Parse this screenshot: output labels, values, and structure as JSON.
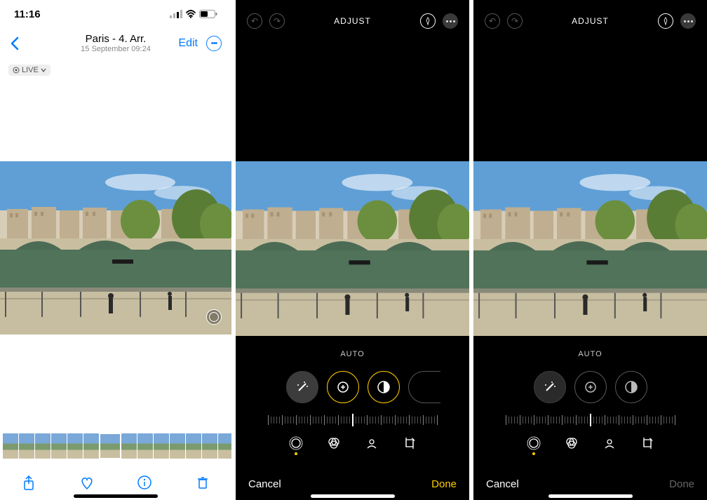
{
  "pane1": {
    "status": {
      "time": "11:16"
    },
    "nav": {
      "title": "Paris - 4. Arr.",
      "subtitle": "15 September  09:24",
      "edit": "Edit"
    },
    "live_badge": "LIVE"
  },
  "pane2": {
    "title": "ADJUST",
    "adjustment_label": "AUTO",
    "cancel": "Cancel",
    "done": "Done",
    "done_enabled": true,
    "active_tool_index": 2
  },
  "pane3": {
    "title": "ADJUST",
    "adjustment_label": "AUTO",
    "cancel": "Cancel",
    "done": "Done",
    "done_enabled": false,
    "active_tool_index": 0
  },
  "icons": {
    "undo": "↶",
    "redo": "↷"
  }
}
